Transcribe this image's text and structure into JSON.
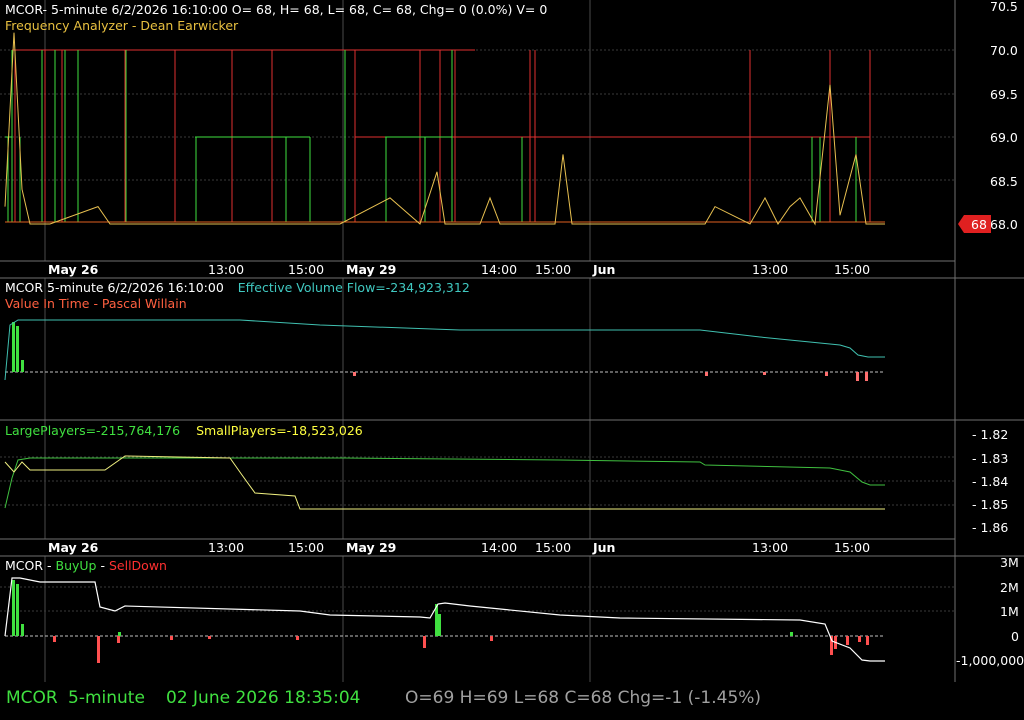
{
  "colors": {
    "bg": "#000000",
    "grid": "#3a3a3a",
    "green": "#40e040",
    "red": "#e03030",
    "orange": "#e8a030",
    "yellow": "#ffff60",
    "white": "#ffffff",
    "teal": "#40c8c0",
    "salmon": "#ff6040",
    "status_green": "#40e040",
    "status_gray": "#a0a0a0"
  },
  "panel1": {
    "header_line1": "MCOR- 5-minute 6/2/2026 16:10:00 O= 68, H= 68, L= 68, C= 68, Chg= 0 (0.0%) V= 0",
    "header_line2": "Frequency Analyzer - Dean Earwicker",
    "y_ticks": [
      "70.5",
      "70.0",
      "69.5",
      "69.0",
      "68.5",
      "68.0"
    ],
    "price_tag": "68"
  },
  "date_axis": {
    "bold_labels": [
      "May 26",
      "May 29",
      "Jun"
    ],
    "time_labels": [
      "13:00",
      "15:00",
      "14:00",
      "15:00",
      "13:00",
      "15:00"
    ]
  },
  "panel2": {
    "title": "MCOR 5-minute  6/2/2026 16:10:00",
    "indicator": "Effective Volume Flow=-234,923,312",
    "subtitle": "Value In Time - Pascal Willain"
  },
  "panel3": {
    "large": "LargePlayers=-215,764,176",
    "small": "SmallPlayers=-18,523,026",
    "y_ticks": [
      "- 1.82",
      "- 1.83",
      "- 1.84",
      "- 1.85",
      "- 1.86"
    ]
  },
  "panel4": {
    "prefix": "MCOR - ",
    "buy": "BuyUp",
    "dash": "-",
    "sell": "SellDown",
    "y_ticks": [
      "3M",
      "2M",
      "1M",
      "0",
      "-1,000,000"
    ]
  },
  "status": {
    "symbol": "MCOR",
    "interval": "5-minute",
    "datetime": "02 June 2026 18:35:04",
    "ohlc": "O=69  H=69  L=68  C=68  Chg=-1 (-1.45%)"
  },
  "chart_data": {
    "type": "line",
    "price_panel": {
      "y_axis_ticks": [
        70.5,
        70.0,
        69.5,
        69.0,
        68.5,
        68.0
      ],
      "last_price": 68,
      "price_line": [
        68.2,
        70.2,
        68.4,
        68.0,
        68.0,
        68.0,
        68.2,
        68.0,
        68.0,
        68.0,
        68.0,
        68.0,
        68.0,
        68.3,
        68.0,
        68.6,
        68.0,
        68.0,
        68.3,
        68.0,
        68.0,
        68.0,
        68.8,
        68.0,
        68.0,
        68.0,
        68.0,
        68.0,
        68.2,
        68.0,
        68.3,
        68.0,
        68.2,
        68.3,
        68.0,
        69.6,
        68.1,
        68.8,
        68.0,
        68.0
      ]
    },
    "large_players_last": -215764176,
    "small_players_last": -18523026,
    "effective_volume_flow_last": -234923312
  }
}
